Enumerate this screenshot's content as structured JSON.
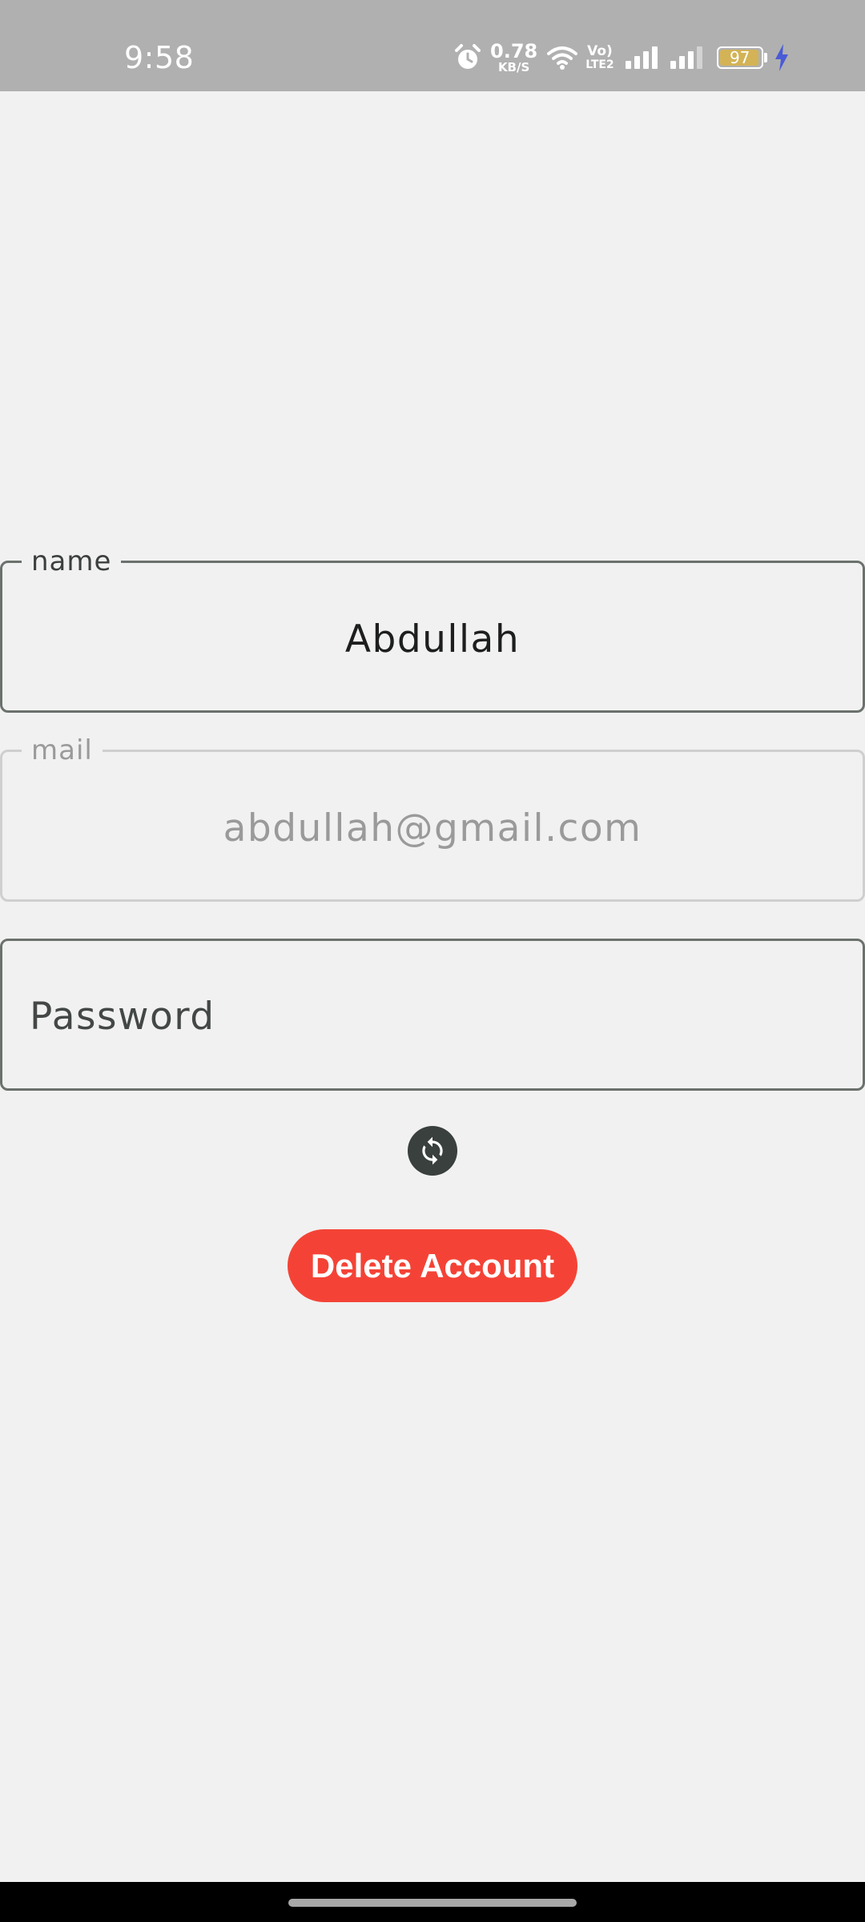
{
  "status_bar": {
    "time": "9:58",
    "net_speed_value": "0.78",
    "net_speed_unit": "KB/S",
    "volte_top": "Vo)",
    "volte_bottom": "LTE2",
    "battery_level": "97",
    "battery_fraction": 0.97,
    "icons": [
      "alarm-icon",
      "wifi-icon",
      "signal-icon",
      "signal-icon",
      "battery-icon",
      "charging-bolt-icon"
    ],
    "colors": {
      "background": "#b0b0b0",
      "battery_fill": "#d3b356",
      "bolt": "#4a5bd6"
    }
  },
  "form": {
    "name": {
      "label": "name",
      "value": "Abdullah"
    },
    "mail": {
      "label": "mail",
      "value": "abdullah@gmail.com",
      "disabled": true
    },
    "password": {
      "placeholder": "Password",
      "value": ""
    },
    "refresh_icon": "refresh-icon",
    "delete_label": "Delete Account"
  },
  "colors": {
    "background": "#f1f1f1",
    "field_border": "#6b716d",
    "delete_button": "#f44336",
    "refresh_button": "#39403d"
  }
}
